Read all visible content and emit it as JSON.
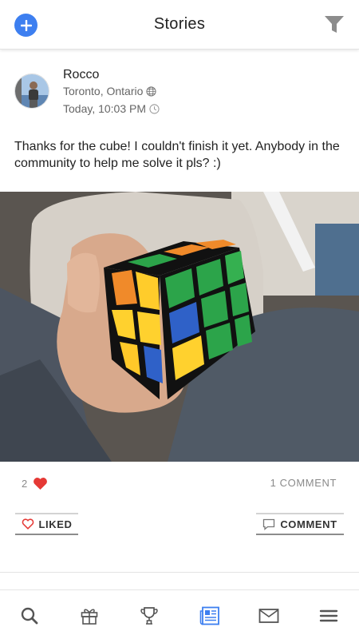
{
  "header": {
    "title": "Stories",
    "add_icon": "plus-circle-icon",
    "filter_icon": "funnel-icon",
    "accent": "#3d7ff0"
  },
  "post": {
    "author": "Rocco",
    "location": "Toronto, Ontario",
    "time": "Today, 10:03 PM",
    "text": "Thanks for the cube! I couldn't finish it yet. Anybody in the community to help me solve it pls? :)",
    "likes": "2",
    "comments": "1 COMMENT",
    "like_button": "LIKED",
    "comment_button": "COMMENT",
    "heart_color": "#e53935"
  },
  "tabbar": {
    "items": [
      "search-icon",
      "gift-icon",
      "trophy-icon",
      "newspaper-icon",
      "mail-icon",
      "menu-icon"
    ],
    "active": "newspaper-icon"
  }
}
